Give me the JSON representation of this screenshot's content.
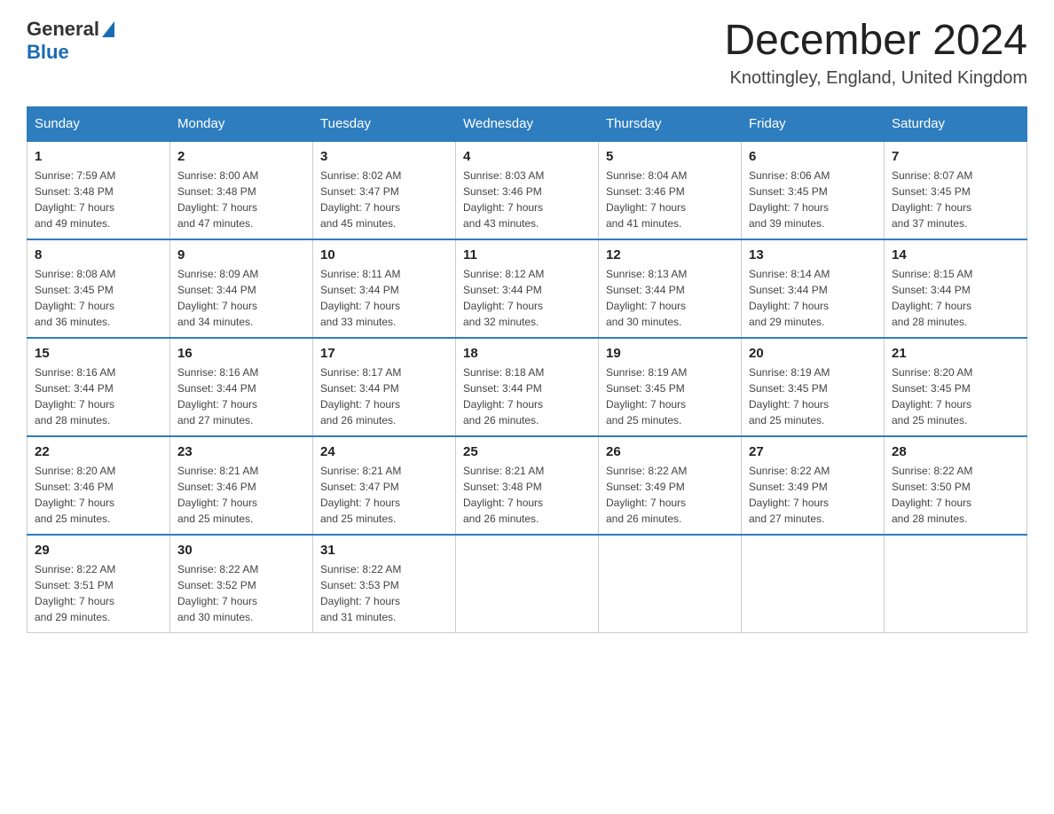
{
  "header": {
    "logo": {
      "general": "General",
      "blue": "Blue"
    },
    "title": "December 2024",
    "location": "Knottingley, England, United Kingdom"
  },
  "days_of_week": [
    "Sunday",
    "Monday",
    "Tuesday",
    "Wednesday",
    "Thursday",
    "Friday",
    "Saturday"
  ],
  "weeks": [
    [
      {
        "day": "1",
        "sunrise": "7:59 AM",
        "sunset": "3:48 PM",
        "daylight": "7 hours and 49 minutes."
      },
      {
        "day": "2",
        "sunrise": "8:00 AM",
        "sunset": "3:48 PM",
        "daylight": "7 hours and 47 minutes."
      },
      {
        "day": "3",
        "sunrise": "8:02 AM",
        "sunset": "3:47 PM",
        "daylight": "7 hours and 45 minutes."
      },
      {
        "day": "4",
        "sunrise": "8:03 AM",
        "sunset": "3:46 PM",
        "daylight": "7 hours and 43 minutes."
      },
      {
        "day": "5",
        "sunrise": "8:04 AM",
        "sunset": "3:46 PM",
        "daylight": "7 hours and 41 minutes."
      },
      {
        "day": "6",
        "sunrise": "8:06 AM",
        "sunset": "3:45 PM",
        "daylight": "7 hours and 39 minutes."
      },
      {
        "day": "7",
        "sunrise": "8:07 AM",
        "sunset": "3:45 PM",
        "daylight": "7 hours and 37 minutes."
      }
    ],
    [
      {
        "day": "8",
        "sunrise": "8:08 AM",
        "sunset": "3:45 PM",
        "daylight": "7 hours and 36 minutes."
      },
      {
        "day": "9",
        "sunrise": "8:09 AM",
        "sunset": "3:44 PM",
        "daylight": "7 hours and 34 minutes."
      },
      {
        "day": "10",
        "sunrise": "8:11 AM",
        "sunset": "3:44 PM",
        "daylight": "7 hours and 33 minutes."
      },
      {
        "day": "11",
        "sunrise": "8:12 AM",
        "sunset": "3:44 PM",
        "daylight": "7 hours and 32 minutes."
      },
      {
        "day": "12",
        "sunrise": "8:13 AM",
        "sunset": "3:44 PM",
        "daylight": "7 hours and 30 minutes."
      },
      {
        "day": "13",
        "sunrise": "8:14 AM",
        "sunset": "3:44 PM",
        "daylight": "7 hours and 29 minutes."
      },
      {
        "day": "14",
        "sunrise": "8:15 AM",
        "sunset": "3:44 PM",
        "daylight": "7 hours and 28 minutes."
      }
    ],
    [
      {
        "day": "15",
        "sunrise": "8:16 AM",
        "sunset": "3:44 PM",
        "daylight": "7 hours and 28 minutes."
      },
      {
        "day": "16",
        "sunrise": "8:16 AM",
        "sunset": "3:44 PM",
        "daylight": "7 hours and 27 minutes."
      },
      {
        "day": "17",
        "sunrise": "8:17 AM",
        "sunset": "3:44 PM",
        "daylight": "7 hours and 26 minutes."
      },
      {
        "day": "18",
        "sunrise": "8:18 AM",
        "sunset": "3:44 PM",
        "daylight": "7 hours and 26 minutes."
      },
      {
        "day": "19",
        "sunrise": "8:19 AM",
        "sunset": "3:45 PM",
        "daylight": "7 hours and 25 minutes."
      },
      {
        "day": "20",
        "sunrise": "8:19 AM",
        "sunset": "3:45 PM",
        "daylight": "7 hours and 25 minutes."
      },
      {
        "day": "21",
        "sunrise": "8:20 AM",
        "sunset": "3:45 PM",
        "daylight": "7 hours and 25 minutes."
      }
    ],
    [
      {
        "day": "22",
        "sunrise": "8:20 AM",
        "sunset": "3:46 PM",
        "daylight": "7 hours and 25 minutes."
      },
      {
        "day": "23",
        "sunrise": "8:21 AM",
        "sunset": "3:46 PM",
        "daylight": "7 hours and 25 minutes."
      },
      {
        "day": "24",
        "sunrise": "8:21 AM",
        "sunset": "3:47 PM",
        "daylight": "7 hours and 25 minutes."
      },
      {
        "day": "25",
        "sunrise": "8:21 AM",
        "sunset": "3:48 PM",
        "daylight": "7 hours and 26 minutes."
      },
      {
        "day": "26",
        "sunrise": "8:22 AM",
        "sunset": "3:49 PM",
        "daylight": "7 hours and 26 minutes."
      },
      {
        "day": "27",
        "sunrise": "8:22 AM",
        "sunset": "3:49 PM",
        "daylight": "7 hours and 27 minutes."
      },
      {
        "day": "28",
        "sunrise": "8:22 AM",
        "sunset": "3:50 PM",
        "daylight": "7 hours and 28 minutes."
      }
    ],
    [
      {
        "day": "29",
        "sunrise": "8:22 AM",
        "sunset": "3:51 PM",
        "daylight": "7 hours and 29 minutes."
      },
      {
        "day": "30",
        "sunrise": "8:22 AM",
        "sunset": "3:52 PM",
        "daylight": "7 hours and 30 minutes."
      },
      {
        "day": "31",
        "sunrise": "8:22 AM",
        "sunset": "3:53 PM",
        "daylight": "7 hours and 31 minutes."
      },
      null,
      null,
      null,
      null
    ]
  ],
  "labels": {
    "sunrise": "Sunrise:",
    "sunset": "Sunset:",
    "daylight": "Daylight:"
  }
}
